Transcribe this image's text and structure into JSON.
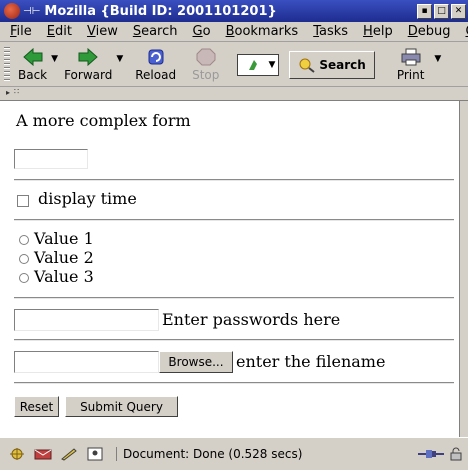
{
  "window": {
    "title": "Mozilla {Build ID: 2001101201}",
    "title_prefix": "⊣⊢"
  },
  "menu": {
    "items": [
      {
        "underline": "F",
        "rest": "ile"
      },
      {
        "underline": "E",
        "rest": "dit"
      },
      {
        "underline": "V",
        "rest": "iew"
      },
      {
        "underline": "S",
        "rest": "earch"
      },
      {
        "underline": "G",
        "rest": "o"
      },
      {
        "underline": "B",
        "rest": "ookmarks"
      },
      {
        "underline": "T",
        "rest": "asks"
      },
      {
        "underline": "H",
        "rest": "elp"
      },
      {
        "underline": "D",
        "rest": "ebug"
      },
      {
        "underline": "Q",
        "rest": ""
      }
    ]
  },
  "toolbar": {
    "back": "Back",
    "forward": "Forward",
    "reload": "Reload",
    "stop": "Stop",
    "search": "Search",
    "print": "Print"
  },
  "form": {
    "heading": "A more complex form",
    "text_value": "",
    "checkbox_label": "display time",
    "radios": [
      "Value 1",
      "Value 2",
      "Value 3"
    ],
    "password_label": "Enter passwords here",
    "password_value": "",
    "file_value": "",
    "browse_label": "Browse...",
    "file_label": "enter the filename",
    "reset_label": "Reset",
    "submit_label": "Submit Query"
  },
  "status": {
    "text": "Document: Done (0.528 secs)"
  },
  "colors": {
    "titlebar": "#1d2c8f",
    "chrome": "#d4d0c8",
    "page": "#ffffff"
  }
}
